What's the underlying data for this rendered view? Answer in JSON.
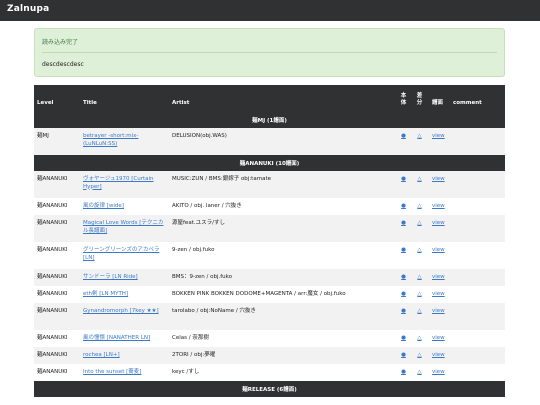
{
  "app": {
    "brand": "Zalnupa"
  },
  "alert": {
    "heading": "読み込み完了",
    "body": "descdescdesc"
  },
  "table": {
    "headers": {
      "level": "Level",
      "title": "Title",
      "artist": "Artist",
      "main": "本\n体",
      "diff": "差\n分",
      "chart": "譜面",
      "comment": "comment"
    },
    "sections": [
      {
        "label": "麺MJ (1譜面)",
        "rows": [
          {
            "level": "麺MJ",
            "title": "betrayer -short:mix- (LuNLuN:SS)",
            "artist": "DELUSION(obj.WAS)",
            "main": "●",
            "diff": "△",
            "view": "view",
            "comment": "",
            "h": 27
          }
        ]
      },
      {
        "label": "麺ANANUKI (10譜面)",
        "rows": [
          {
            "level": "麺ANANUKI",
            "title": "ヴォヤージュ1970 [Curtain Hyper]",
            "artist": "MUSIC:ZUN / BMS:銀嫁子 obj:tamate",
            "main": "●",
            "diff": "△",
            "view": "view",
            "comment": "",
            "h": 27
          },
          {
            "level": "麺ANANUKI",
            "title": "風の旋律 [wide]",
            "artist": "AKITO / obj. laner / 穴抜き",
            "main": "●",
            "diff": "△",
            "view": "view",
            "comment": "",
            "h": 17
          },
          {
            "level": "麺ANANUKI",
            "title": "Magical Love Words [テクニカル長譜面]",
            "artist": "源屋feat.ユスラ/すし",
            "main": "●",
            "diff": "△",
            "view": "view",
            "comment": "",
            "h": 27
          },
          {
            "level": "麺ANANUKI",
            "title": "グリーングリーンズのアカペラ [LN]",
            "artist": "9-zen / obj.fuko",
            "main": "●",
            "diff": "△",
            "view": "view",
            "comment": "",
            "h": 27
          },
          {
            "level": "麺ANANUKI",
            "title": "サンドーラ [LN Ride]",
            "artist": "BMS：9-zen / obj.fuko",
            "main": "●",
            "diff": "△",
            "view": "view",
            "comment": "",
            "h": 17
          },
          {
            "level": "麺ANANUKI",
            "title": "eth剣 [LN MYTH]",
            "artist": "BOKKEN PINK BOKKEN DODOME+MAGENTA / arr:魔女 / obj.fuko",
            "main": "●",
            "diff": "△",
            "view": "view",
            "comment": "",
            "h": 17
          },
          {
            "level": "麺ANANUKI",
            "title": "Gynandromorph [7key ★★]",
            "artist": "tarolabo / obj:NoName / 穴抜き",
            "main": "●",
            "diff": "△",
            "view": "view",
            "comment": "",
            "h": 27
          },
          {
            "level": "麺ANANUKI",
            "title": "風の憧憬 [NANATHER LN]",
            "artist": "Celas / 奈那樹",
            "main": "●",
            "diff": "△",
            "view": "view",
            "comment": "",
            "h": 17
          },
          {
            "level": "麺ANANUKI",
            "title": "rochea [LN+]",
            "artist": "2TORI / obj:夢曜",
            "main": "●",
            "diff": "△",
            "view": "view",
            "comment": "",
            "h": 17
          },
          {
            "level": "麺ANANUKI",
            "title": "Into the sunset [蕎麦]",
            "artist": "keyc /すし",
            "main": "●",
            "diff": "△",
            "view": "view",
            "comment": "",
            "h": 17
          }
        ]
      },
      {
        "label": "麺RELEASE (6譜面)",
        "rows": []
      }
    ]
  },
  "colors": {
    "navbar": "#303133",
    "alert_bg": "#dff0d8",
    "alert_text": "#3c763d",
    "link": "#3a78c8",
    "row_alt": "#f2f2f2"
  }
}
